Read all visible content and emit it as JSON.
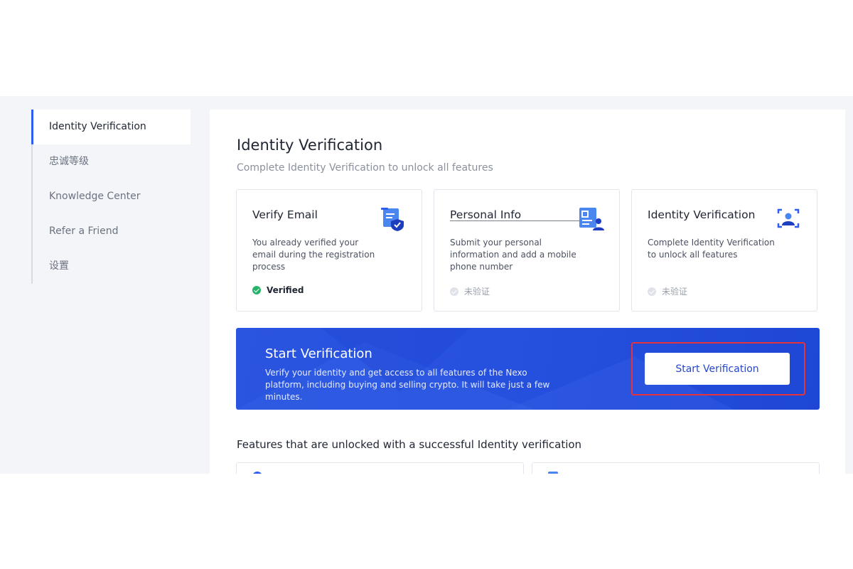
{
  "sidebar": {
    "items": [
      {
        "label": "Identity Verification",
        "active": true
      },
      {
        "label": "忠诚等级",
        "active": false
      },
      {
        "label": "Knowledge Center",
        "active": false
      },
      {
        "label": "Refer a Friend",
        "active": false
      },
      {
        "label": "设置",
        "active": false
      }
    ]
  },
  "main": {
    "title": "Identity Verification",
    "subtitle": "Complete Identity Verification to unlock all features",
    "cards": [
      {
        "title": "Verify Email",
        "description": "You already verified your email during the registration process",
        "status": "Verified",
        "status_state": "verified",
        "icon": "email-shield-icon"
      },
      {
        "title": "Personal Info",
        "description": "Submit your personal information and add a mobile phone number",
        "status": "未验证",
        "status_state": "unverified",
        "icon": "id-card-icon"
      },
      {
        "title": "Identity Verification",
        "description": "Complete Identity Verification to unlock all features",
        "status": "未验证",
        "status_state": "unverified",
        "icon": "face-scan-icon"
      }
    ],
    "banner": {
      "title": "Start Verification",
      "description": "Verify your identity and get access to all features of the Nexo platform, including buying and selling crypto. It will take just a few minutes.",
      "button_label": "Start Verification"
    },
    "features_title": "Features that are unlocked with a successful Identity verification"
  },
  "colors": {
    "accent": "#2d5ef0",
    "banner": "#2650de",
    "verified": "#27b36a",
    "highlight": "#e5323b"
  }
}
